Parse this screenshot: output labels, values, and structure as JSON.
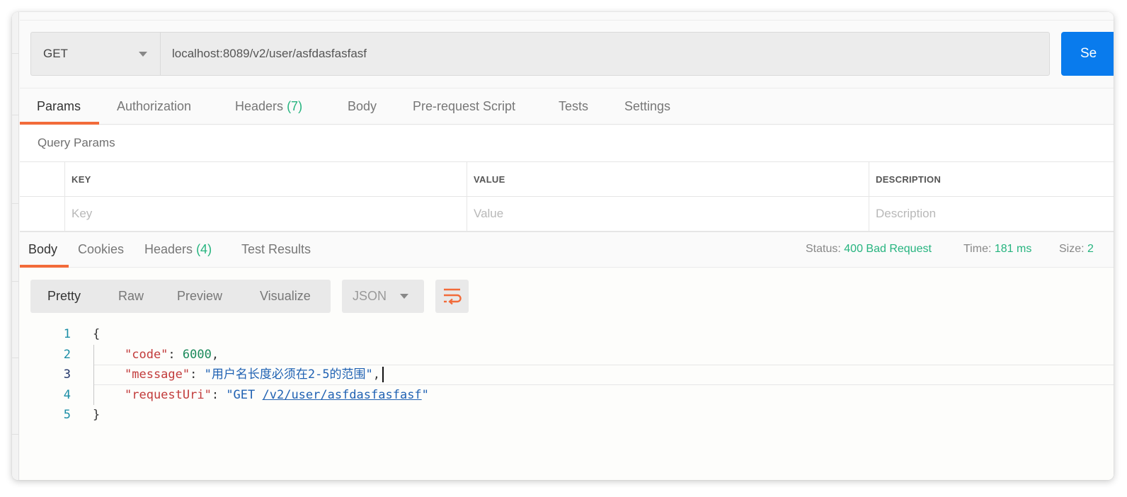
{
  "request": {
    "method": "GET",
    "url": "localhost:8089/v2/user/asfdasfasfasf",
    "send_label": "Se"
  },
  "request_tabs": [
    {
      "label": "Params",
      "count": "",
      "active": true
    },
    {
      "label": "Authorization",
      "count": ""
    },
    {
      "label": "Headers",
      "count": "(7)"
    },
    {
      "label": "Body",
      "count": ""
    },
    {
      "label": "Pre-request Script",
      "count": ""
    },
    {
      "label": "Tests",
      "count": ""
    },
    {
      "label": "Settings",
      "count": ""
    }
  ],
  "query_params": {
    "title": "Query Params",
    "columns": [
      "KEY",
      "VALUE",
      "DESCRIPTION"
    ],
    "placeholders": [
      "Key",
      "Value",
      "Description"
    ]
  },
  "response_tabs": [
    {
      "label": "Body",
      "count": "",
      "active": true
    },
    {
      "label": "Cookies",
      "count": ""
    },
    {
      "label": "Headers",
      "count": "(4)"
    },
    {
      "label": "Test Results",
      "count": ""
    }
  ],
  "response_meta": {
    "status_label": "Status:",
    "status_value": "400 Bad Request",
    "time_label": "Time:",
    "time_value": "181 ms",
    "size_label": "Size:",
    "size_value": "2"
  },
  "view_modes": [
    "Pretty",
    "Raw",
    "Preview",
    "Visualize"
  ],
  "active_view": "Pretty",
  "format": "JSON",
  "wrap_icon": "wrap-lines-icon",
  "code": {
    "line_numbers": [
      "1",
      "2",
      "3",
      "4",
      "5"
    ],
    "open_brace": "{",
    "close_brace": "}",
    "code_key": "\"code\"",
    "code_value": "6000",
    "message_key": "\"message\"",
    "message_value": "\"用户名长度必须在2-5的范围\"",
    "requestUri_key": "\"requestUri\"",
    "requestUri_prefix": "\"GET ",
    "requestUri_link": "/v2/user/asfdasfasfasf",
    "requestUri_suffix": "\""
  },
  "colors": {
    "accent_orange": "#f26b3a",
    "send_blue": "#097bed",
    "status_green": "#26b47f"
  }
}
